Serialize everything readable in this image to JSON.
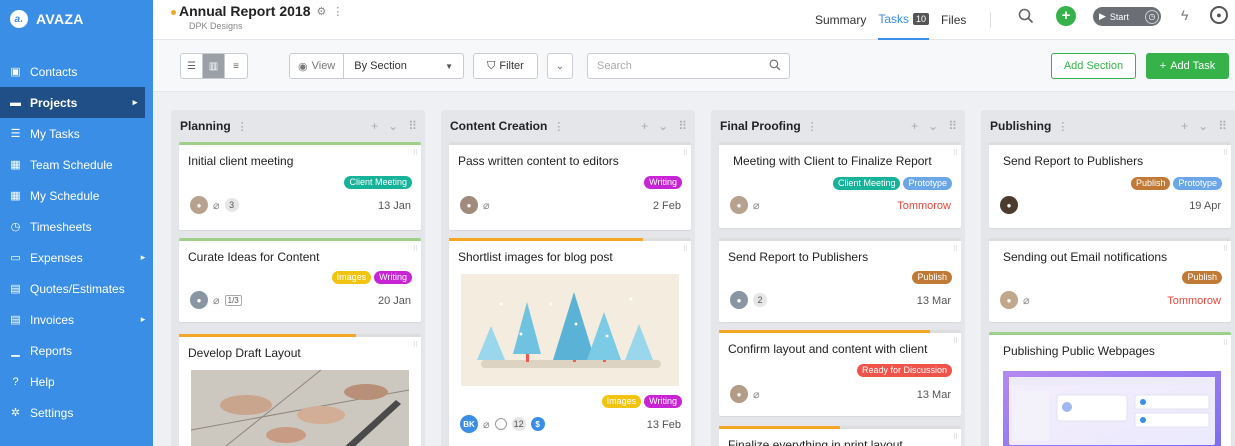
{
  "app": {
    "brand": "AVAZA",
    "logo_glyph": "a."
  },
  "colors": {
    "sidebar": "#3a8ee6",
    "active_nav": "#1f4f86",
    "green": "#36b24b",
    "teal": "#16b39a",
    "magenta": "#c824d6",
    "yellow": "#f2c40f",
    "brown": "#c07a36",
    "blue_tag": "#6ba7e8",
    "red_tag": "#f0534a",
    "orange_bar": "#f5a623"
  },
  "sidebar": {
    "items": [
      {
        "label": "Contacts",
        "icon": "contacts-icon",
        "glyph": "▣"
      },
      {
        "label": "Projects",
        "icon": "folder-icon",
        "glyph": "▬",
        "active": true,
        "caret": "▸"
      },
      {
        "label": "My Tasks",
        "icon": "tasks-icon",
        "glyph": "☰"
      },
      {
        "label": "Team Schedule",
        "icon": "calendar-icon",
        "glyph": "▦"
      },
      {
        "label": "My Schedule",
        "icon": "calendar-check-icon",
        "glyph": "▦"
      },
      {
        "label": "Timesheets",
        "icon": "timer-icon",
        "glyph": "◷"
      },
      {
        "label": "Expenses",
        "icon": "card-icon",
        "glyph": "▭",
        "caret": "▸"
      },
      {
        "label": "Quotes/Estimates",
        "icon": "calculator-icon",
        "glyph": "▤"
      },
      {
        "label": "Invoices",
        "icon": "invoice-icon",
        "glyph": "▤",
        "caret": "▸"
      },
      {
        "label": "Reports",
        "icon": "chart-icon",
        "glyph": "▁"
      },
      {
        "label": "Help",
        "icon": "help-icon",
        "glyph": "?"
      },
      {
        "label": "Settings",
        "icon": "gear-icon",
        "glyph": "✲"
      }
    ]
  },
  "header": {
    "title": "Annual Report 2018",
    "subtitle": "DPK Designs",
    "tabs": [
      {
        "label": "Summary",
        "active": false
      },
      {
        "label": "Tasks",
        "badge": "10",
        "active": true
      },
      {
        "label": "Files",
        "active": false
      }
    ],
    "start_label": "Start"
  },
  "toolbar": {
    "view_label": "View",
    "view_value": "By Section",
    "filter_label": "Filter",
    "search_placeholder": "Search",
    "add_section": "Add Section",
    "add_task": "Add Task"
  },
  "columns": [
    {
      "title": "Planning",
      "cards": [
        {
          "title": "Initial client meeting",
          "tags": [
            {
              "label": "Client Meeting",
              "color": "#16b39a"
            }
          ],
          "count": "3",
          "date": "13 Jan",
          "top": "#9fd08a",
          "avatar": "#b7a28f"
        },
        {
          "title": "Curate Ideas for Content",
          "tags": [
            {
              "label": "Images",
              "color": "#f2c40f"
            },
            {
              "label": "Writing",
              "color": "#c824d6"
            }
          ],
          "subtasks": "1/3",
          "date": "20 Jan",
          "top": "#9fd08a",
          "avatar": "#8a95a3"
        },
        {
          "title": "Develop Draft Layout",
          "progress": 0.73,
          "top": "#ddd"
        }
      ]
    },
    {
      "title": "Content Creation",
      "cards": [
        {
          "title": "Pass written content to editors",
          "tags": [
            {
              "label": "Writing",
              "color": "#c824d6"
            }
          ],
          "date": "2 Feb",
          "top": "#ddd",
          "avatar": "#a08b7c"
        },
        {
          "title": "Shortlist images for blog post",
          "progress": 0.8,
          "tags": [
            {
              "label": "Images",
              "color": "#f2c40f"
            },
            {
              "label": "Writing",
              "color": "#c824d6"
            }
          ],
          "initials": "BK",
          "count": "12",
          "date": "13 Feb",
          "top": "#ddd"
        }
      ]
    },
    {
      "title": "Final Proofing",
      "cards": [
        {
          "title": "Meeting with Client to Finalize Report",
          "tags": [
            {
              "label": "Client Meeting",
              "color": "#16b39a"
            },
            {
              "label": "Prototype",
              "color": "#6ba7e8"
            }
          ],
          "date": "Tommorow",
          "overdue": true,
          "top": "#ddd",
          "avatar": "#b7a28f"
        },
        {
          "title": "Send Report to Publishers",
          "tags": [
            {
              "label": "Publish",
              "color": "#c07a36"
            }
          ],
          "count": "2",
          "date": "13 Mar",
          "top": "#ddd",
          "avatar": "#8a95a3"
        },
        {
          "title": "Confirm layout and content with client",
          "progress": 0.87,
          "tags": [
            {
              "label": "Ready for Discussion",
              "color": "#f0534a"
            }
          ],
          "date": "13 Mar",
          "top": "#ddd",
          "avatar": "#b39c86"
        },
        {
          "title": "Finalize everything in print layout",
          "top": "#ddd",
          "progress": 0.5
        }
      ]
    },
    {
      "title": "Publishing",
      "cards": [
        {
          "title": "Send Report to Publishers",
          "tags": [
            {
              "label": "Publish",
              "color": "#c07a36"
            },
            {
              "label": "Prototype",
              "color": "#6ba7e8"
            }
          ],
          "date": "19 Apr",
          "top": "#ddd",
          "avatar": "#4d3b30"
        },
        {
          "title": "Sending out Email notifications",
          "tags": [
            {
              "label": "Publish",
              "color": "#c07a36"
            }
          ],
          "date": "Tommorow",
          "overdue": true,
          "top": "#ddd",
          "avatar": "#c1a78c"
        },
        {
          "title": "Publishing Public Webpages",
          "top": "#9fd08a"
        }
      ]
    }
  ]
}
